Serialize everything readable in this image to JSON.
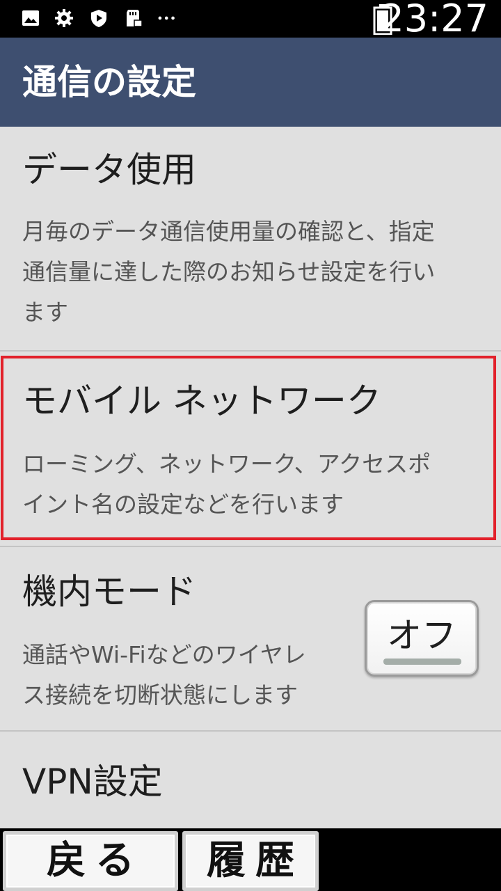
{
  "status_bar": {
    "time": "23:27",
    "icons": [
      "image-icon",
      "gear-icon",
      "play-shield-icon",
      "sd-card-lock-icon",
      "more-dots-icon"
    ],
    "battery": "battery-icon"
  },
  "header": {
    "title": "通信の設定"
  },
  "settings": {
    "data_usage": {
      "title": "データ使用",
      "desc_lines": [
        "月毎のデータ通信使用量の確認と、指定",
        "通信量に達した際のお知らせ設定を行い",
        "ます"
      ]
    },
    "mobile_network": {
      "title": "モバイル ネットワーク",
      "desc_lines": [
        "ローミング、ネットワーク、アクセスポ",
        "イント名の設定などを行います"
      ]
    },
    "airplane_mode": {
      "title": "機内モード",
      "desc_lines": [
        "通話やWi-Fiなどのワイヤレ",
        "ス接続を切断状態にします"
      ],
      "toggle_label": "オフ"
    },
    "vpn": {
      "title": "VPN設定"
    }
  },
  "bottom_nav": {
    "back_label": "戻る",
    "history_label": "履歴"
  },
  "colors": {
    "header_bg": "#3e4f70",
    "highlight": "#e2212b",
    "content_bg": "#e0e0e0"
  }
}
